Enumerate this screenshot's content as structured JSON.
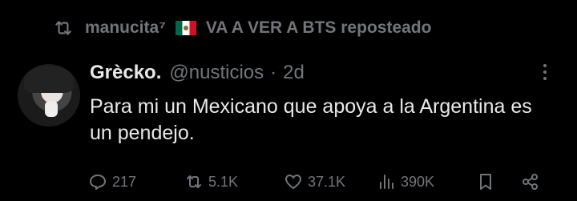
{
  "repost_bar": {
    "reposter": "manucita⁷",
    "label": "VA A VER A BTS reposteado"
  },
  "tweet": {
    "author_name": "Grècko.",
    "author_handle": "@nusticios",
    "separator": "·",
    "timestamp": "2d",
    "text": "Para mi un Mexicano que apoya a la Argentina es un pendejo."
  },
  "actions": {
    "replies": "217",
    "reposts": "5.1K",
    "likes": "37.1K",
    "views": "390K"
  },
  "colors": {
    "background": "#000000",
    "primary_text": "#e7e9ea",
    "secondary_text": "#71767b"
  }
}
